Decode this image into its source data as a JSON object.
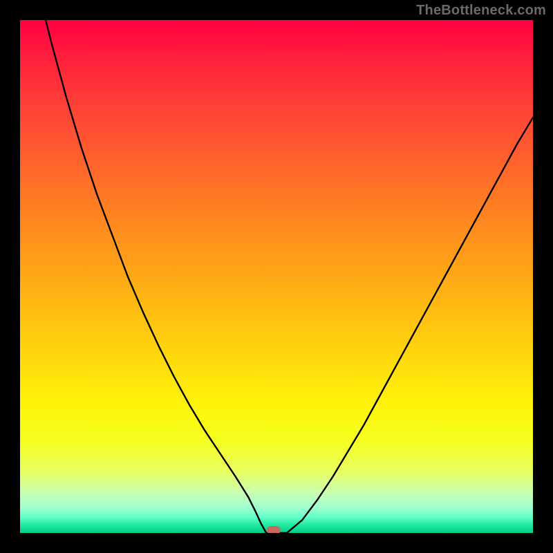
{
  "watermark": {
    "text": "TheBottleneck.com"
  },
  "colors": {
    "gradient_top": "#ff0040",
    "gradient_bottom": "#00d088",
    "curve": "#000000",
    "marker": "#c96a5e",
    "frame": "#000000"
  },
  "chart_data": {
    "type": "line",
    "title": "",
    "xlabel": "",
    "ylabel": "",
    "xlim": [
      0,
      100
    ],
    "ylim": [
      0,
      100
    ],
    "x": [
      0,
      3,
      6,
      9,
      12,
      15,
      18,
      21,
      24,
      27,
      30,
      33,
      36,
      39,
      42,
      44.5,
      46,
      47,
      48,
      52,
      55,
      58,
      61,
      64,
      67,
      70,
      73,
      76,
      79,
      82,
      85,
      88,
      91,
      94,
      97,
      100
    ],
    "values": [
      125,
      108,
      96,
      85,
      75,
      66,
      58,
      50,
      43,
      36.5,
      30.5,
      25,
      20,
      15.5,
      11,
      7,
      4,
      1.8,
      0,
      0,
      2.5,
      6.5,
      11,
      16,
      21,
      26.5,
      32,
      37.5,
      43,
      48.5,
      54,
      59.5,
      65,
      70.5,
      76,
      81
    ],
    "marker": {
      "x": 49.5,
      "y": 0
    }
  }
}
